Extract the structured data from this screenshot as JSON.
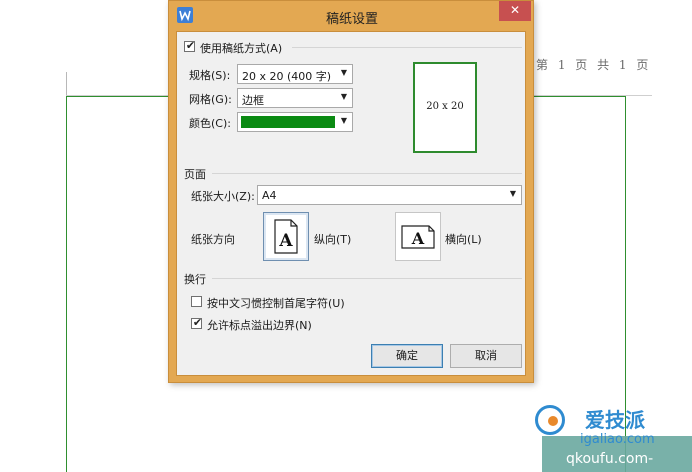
{
  "document": {
    "page_number": "第 1 页 共 1 页"
  },
  "dialog": {
    "title": "稿纸设置",
    "close_icon": "close-icon",
    "use_paper_checkbox": {
      "label": "使用稿纸方式(A)",
      "checked": true
    },
    "spec": {
      "label": "规格(S):",
      "value": "20 x 20 (400 字)"
    },
    "grid": {
      "label": "网格(G):",
      "value": "边框"
    },
    "color": {
      "label": "颜色(C):",
      "value": "#0a8a12"
    },
    "preview_label": "20 x 20",
    "page_section": {
      "heading": "页面",
      "paper_size_label": "纸张大小(Z):",
      "paper_size_value": "A4",
      "orientation_label": "纸张方向",
      "portrait_label": "纵向(T)",
      "landscape_label": "横向(L)",
      "portrait_glyph": "A",
      "landscape_glyph": "A",
      "selected": "portrait"
    },
    "linebreak_section": {
      "heading": "换行",
      "cjk_rule": {
        "label": "按中文习惯控制首尾字符(U)",
        "checked": false
      },
      "allow_punct": {
        "label": "允许标点溢出边界(N)",
        "checked": true
      }
    },
    "ok_button": "确定",
    "cancel_button": "取消"
  },
  "watermark": {
    "line1": "爱技派",
    "line2": "igaliao.com",
    "line3": "qkoufu.com-"
  },
  "colors": {
    "titlebar": "#e3a852",
    "close": "#c75050",
    "paper_green": "#2f8f2f"
  }
}
